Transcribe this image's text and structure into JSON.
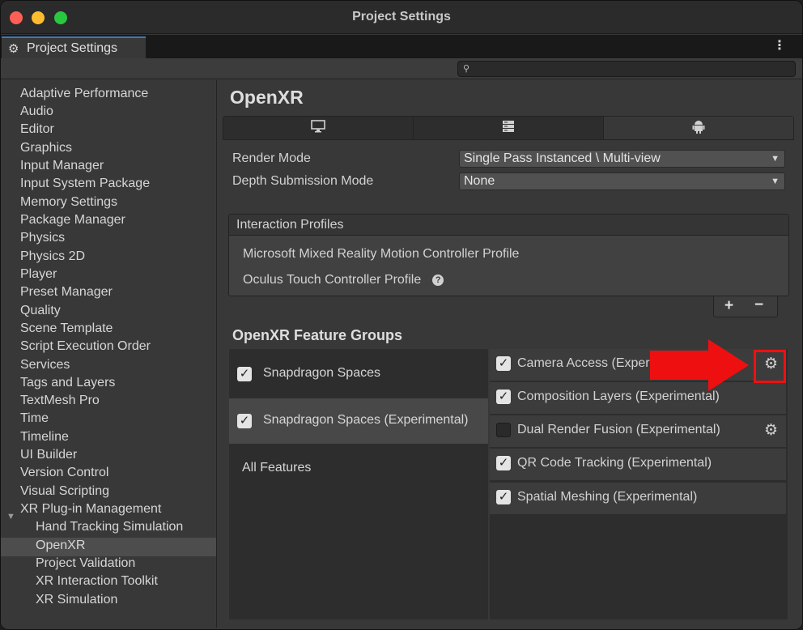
{
  "window": {
    "title": "Project Settings"
  },
  "tab": {
    "label": "Project Settings",
    "icon": "gear-icon"
  },
  "search": {
    "placeholder": ""
  },
  "sidebar": {
    "items": [
      "Adaptive Performance",
      "Audio",
      "Editor",
      "Graphics",
      "Input Manager",
      "Input System Package",
      "Memory Settings",
      "Package Manager",
      "Physics",
      "Physics 2D",
      "Player",
      "Preset Manager",
      "Quality",
      "Scene Template",
      "Script Execution Order",
      "Services",
      "Tags and Layers",
      "TextMesh Pro",
      "Time",
      "Timeline",
      "UI Builder",
      "Version Control",
      "Visual Scripting",
      "XR Plug-in Management"
    ],
    "sub_items": [
      "Hand Tracking Simulation",
      "OpenXR",
      "Project Validation",
      "XR Interaction Toolkit",
      "XR Simulation"
    ],
    "selected": "OpenXR"
  },
  "main": {
    "title": "OpenXR",
    "platform_tabs": [
      "desktop-icon",
      "server-icon",
      "android-icon"
    ],
    "render_mode": {
      "label": "Render Mode",
      "value": "Single Pass Instanced \\ Multi-view"
    },
    "depth_mode": {
      "label": "Depth Submission Mode",
      "value": "None"
    },
    "interaction_profiles": {
      "title": "Interaction Profiles",
      "items": [
        "Microsoft Mixed Reality Motion Controller Profile",
        "Oculus Touch Controller Profile"
      ]
    },
    "feature_groups": {
      "title": "OpenXR Feature Groups",
      "groups": [
        {
          "label": "Snapdragon Spaces",
          "checked": true
        },
        {
          "label": "Snapdragon Spaces (Experimental)",
          "checked": true
        }
      ],
      "all_features": "All Features"
    },
    "features": [
      {
        "label": "Camera Access (Experimental)",
        "checked": true,
        "gear": true
      },
      {
        "label": "Composition Layers (Experimental)",
        "checked": true,
        "gear": false
      },
      {
        "label": "Dual Render Fusion (Experimental)",
        "checked": false,
        "gear": true
      },
      {
        "label": "QR Code Tracking (Experimental)",
        "checked": true,
        "gear": false
      },
      {
        "label": "Spatial Meshing (Experimental)",
        "checked": true,
        "gear": false
      }
    ]
  },
  "annotation": {
    "color": "#ee1010"
  }
}
